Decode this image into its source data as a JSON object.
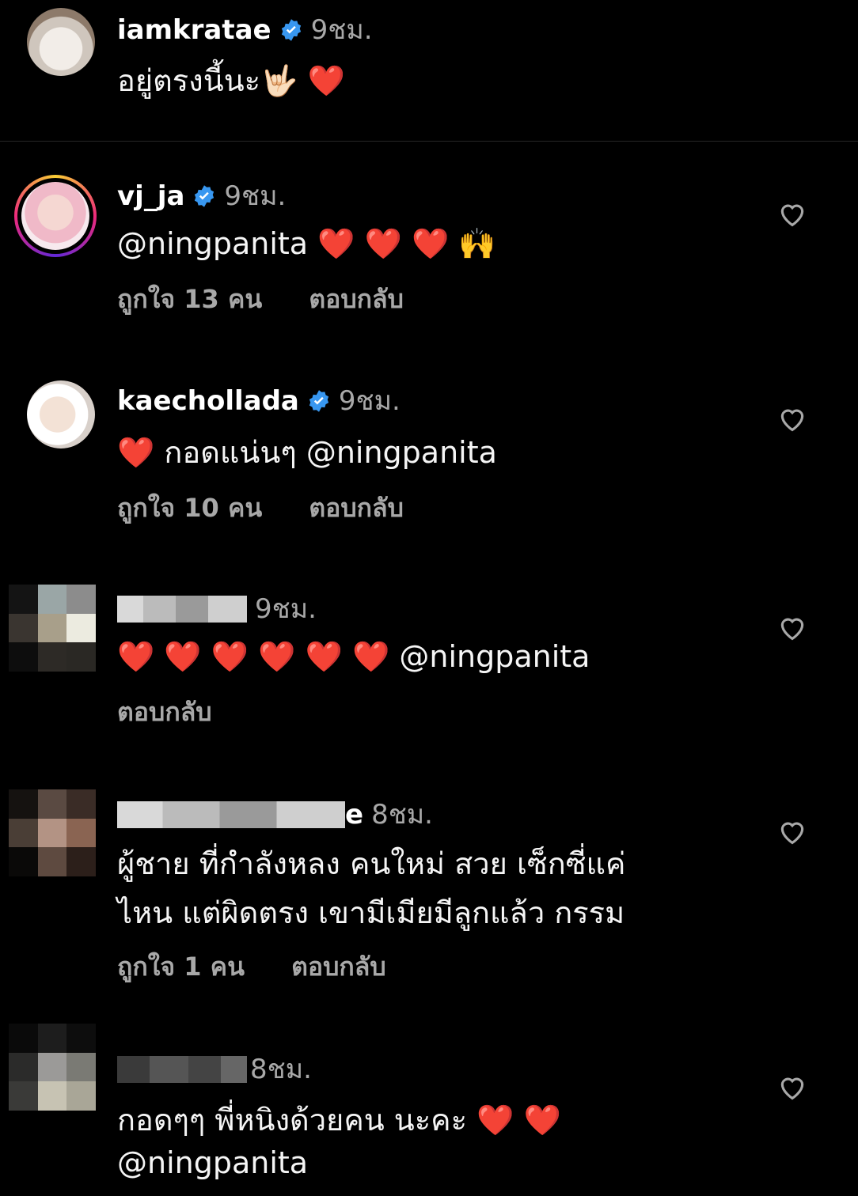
{
  "comments": [
    {
      "username": "iamkratae",
      "verified": true,
      "time": "9ชม.",
      "text": "อยู่ตรงนี้นะ🤟🏻 ❤️",
      "likes": "",
      "reply": ""
    },
    {
      "username": "vj_ja",
      "verified": true,
      "time": "9ชม.",
      "text": "@ningpanita ❤️ ❤️ ❤️ 🙌",
      "likes": "ถูกใจ 13 คน",
      "reply": "ตอบกลับ"
    },
    {
      "username": "kaechollada",
      "verified": true,
      "time": "9ชม.",
      "text": "❤️ กอดแน่นๆ @ningpanita",
      "likes": "ถูกใจ 10 คน",
      "reply": "ตอบกลับ"
    },
    {
      "username": "",
      "verified": false,
      "time": "9ชม.",
      "text": "❤️ ❤️ ❤️ ❤️ ❤️ ❤️ @ningpanita",
      "likes": "",
      "reply": "ตอบกลับ"
    },
    {
      "username": "",
      "username_tail": "e",
      "verified": false,
      "time": "8ชม.",
      "text_line1": "ผู้ชาย  ที่กำลังหลง คนใหม่  สวย เซ็กซี่แค่",
      "text_line2": "ไหน  แต่ผิดตรง  เขามีเมียมีลูกแล้ว  กรรม",
      "likes": "ถูกใจ 1 คน",
      "reply": "ตอบกลับ"
    },
    {
      "username": "",
      "verified": false,
      "time": "8ชม.",
      "text_line1": "กอดๆๆ พี่หนิงด้วยคน นะคะ ❤️ ❤️",
      "text_line2": "@ningpanita",
      "likes": "",
      "reply": ""
    }
  ],
  "icons": {
    "verified": "verified-badge-icon",
    "like": "heart-outline-icon"
  },
  "colors": {
    "background": "#000000",
    "secondary_text": "#a8a8a8",
    "verified_blue": "#3897f0"
  }
}
